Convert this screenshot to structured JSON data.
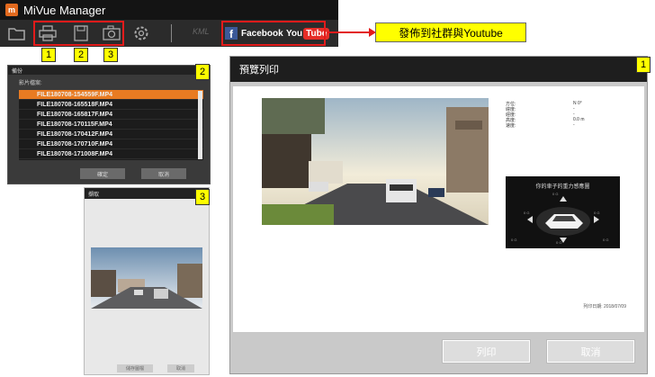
{
  "app": {
    "title": "MiVue Manager",
    "logo_letter": "m"
  },
  "toolbar": {
    "kml_label": "KML",
    "facebook_label": "Facebook",
    "youtube_you": "You",
    "youtube_tube": "Tube"
  },
  "annotations": {
    "n1": "1",
    "n2": "2",
    "n3": "3",
    "callout": "發佈到社群與Youtube"
  },
  "backup_dialog": {
    "title": "備份",
    "subtitle": "影片檔案:",
    "files": [
      "FILE180708-154559F.MP4",
      "FILE180708-165518F.MP4",
      "FILE180708-165817F.MP4",
      "FILE180708-170115F.MP4",
      "FILE180708-170412F.MP4",
      "FILE180708-170710F.MP4",
      "FILE180708-171008F.MP4"
    ],
    "selected_index": 0,
    "ok_label": "確定",
    "cancel_label": "取消"
  },
  "snapshot_dialog": {
    "title": "擷取",
    "save_label": "儲存圖檔",
    "cancel_label": "取消"
  },
  "print_dialog": {
    "title": "預覽列印",
    "info": [
      {
        "label": "方位:",
        "value": "N 0°"
      },
      {
        "label": "緯度:",
        "value": "-"
      },
      {
        "label": "經度:",
        "value": "-"
      },
      {
        "label": "高度:",
        "value": "0.0 m"
      },
      {
        "label": "速度:",
        "value": "-"
      }
    ],
    "panel_caption": "你的車子的重力感應圖",
    "gauge_labels": [
      "0 G",
      "0 G",
      "0 G",
      "0 G",
      "0 G",
      "0 G"
    ],
    "date_text": "列印日期: 2018/07/09",
    "print_label": "列印",
    "cancel_label": "取消"
  },
  "colors": {
    "accent": "#e87b22",
    "annotation_red": "#e31b1b",
    "annotation_yellow": "#ffff00",
    "facebook_blue": "#3b5998",
    "youtube_red": "#e52d27"
  }
}
